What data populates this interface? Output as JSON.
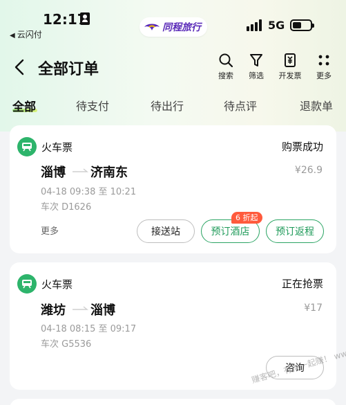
{
  "status_bar": {
    "time": "12:17",
    "back_app": "云闪付",
    "network": "5G"
  },
  "brand": {
    "name": "同程旅行"
  },
  "header": {
    "title": "全部订单",
    "actions": [
      {
        "icon": "search-icon",
        "label": "搜索"
      },
      {
        "icon": "filter-icon",
        "label": "筛选"
      },
      {
        "icon": "invoice-icon",
        "label": "开发票"
      },
      {
        "icon": "more-dots-icon",
        "label": "更多"
      }
    ]
  },
  "tabs": [
    {
      "label": "全部",
      "active": true
    },
    {
      "label": "待支付"
    },
    {
      "label": "待出行"
    },
    {
      "label": "待点评"
    },
    {
      "label": "退款单"
    }
  ],
  "orders": [
    {
      "type": "火车票",
      "status": "购票成功",
      "from": "淄博",
      "to": "济南东",
      "price": "¥26.9",
      "time": "04-18 09:38 至 10:21",
      "train": "车次 D1626",
      "more": "更多",
      "buttons": [
        "接送站",
        "预订酒店",
        "预订返程"
      ],
      "promo": "6 折起"
    },
    {
      "type": "火车票",
      "status": "正在抢票",
      "from": "潍坊",
      "to": "淄博",
      "price": "¥17",
      "time": "04-18 08:15 至 09:17",
      "train": "车次 G5536",
      "buttons": [
        "咨询"
      ]
    }
  ],
  "watermark": "赚客吧，有你一起赚！ www.zuanke8.com",
  "colors": {
    "accent_green": "#2db46b",
    "button_green": "#1e9a59",
    "promo_red": "#ff5a3c",
    "brand_purple": "#5a2ab8"
  }
}
